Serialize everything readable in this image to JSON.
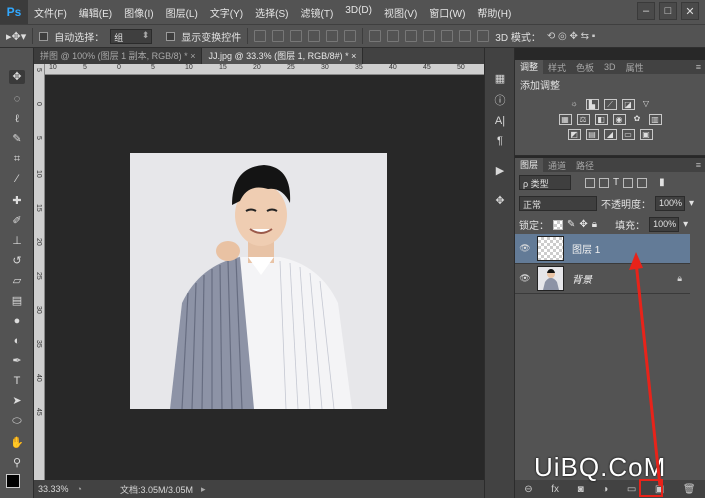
{
  "app": {
    "logo": "Ps"
  },
  "menu": [
    "文件(F)",
    "编辑(E)",
    "图像(I)",
    "图层(L)",
    "文字(Y)",
    "选择(S)",
    "滤镜(T)",
    "3D(D)",
    "视图(V)",
    "窗口(W)",
    "帮助(H)"
  ],
  "window_controls": {
    "minimize": "–",
    "restore": "□",
    "close": "✕"
  },
  "options": {
    "auto_select_label": "自动选择：",
    "auto_select_value": "组",
    "show_transform_label": "显示变换控件",
    "mode_3d_label": "3D 模式："
  },
  "doc_tabs": [
    {
      "label": "拼图 @ 100% (图层 1 副本, RGB/8) *",
      "close": "×",
      "active": false
    },
    {
      "label": "JJ.jpg @ 33.3% (图层 1, RGB/8#) *",
      "close": "×",
      "active": true
    }
  ],
  "ruler_top_ticks": [
    "10",
    "5",
    "0",
    "5",
    "10",
    "15",
    "20",
    "25",
    "30",
    "35",
    "40",
    "45",
    "50"
  ],
  "ruler_left_ticks": [
    "5",
    "0",
    "5",
    "10",
    "15",
    "20",
    "25",
    "30",
    "35",
    "40",
    "45"
  ],
  "status": {
    "zoom": "33.33%",
    "doc": "文档:3.05M/3.05M"
  },
  "adjust_panel": {
    "tabs": [
      "调整",
      "样式",
      "色板",
      "3D",
      "属性"
    ],
    "title": "添加调整"
  },
  "layers_panel": {
    "tabs": [
      "图层",
      "通道",
      "路径"
    ],
    "filter_label": "ρ 类型",
    "blend_mode": "正常",
    "opacity_label": "不透明度：",
    "opacity_value": "100%",
    "lock_label": "锁定：",
    "fill_label": "填充：",
    "fill_value": "100%",
    "layers": [
      {
        "name": "图层 1",
        "selected": true,
        "visible": true
      },
      {
        "name": "背景",
        "selected": false,
        "visible": true,
        "locked": true
      }
    ]
  },
  "watermark": "UiBQ.CoM",
  "colors": {
    "accent_red": "#e8231a",
    "selected_layer": "#637b97",
    "ui_dark": "#535353"
  }
}
